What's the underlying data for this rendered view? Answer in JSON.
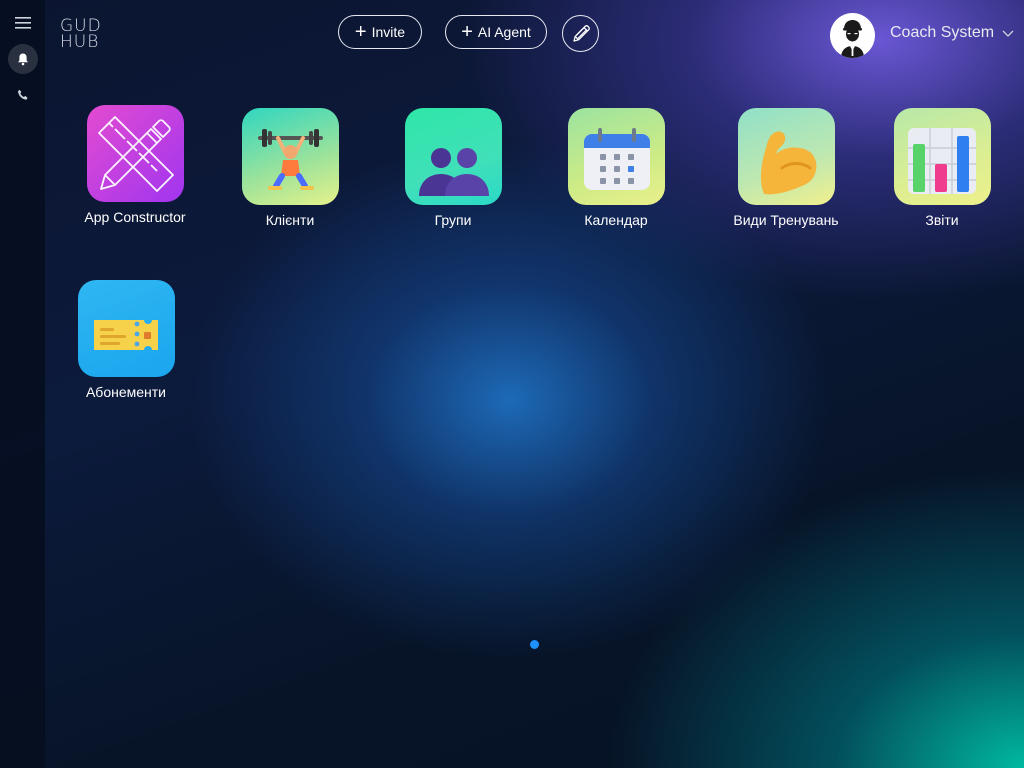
{
  "logo": {
    "line1": "GUD",
    "line2": "HUB"
  },
  "header": {
    "invite_label": "Invite",
    "ai_agent_label": "AI Agent",
    "user_name": "Coach System"
  },
  "sidebar": {
    "items": [
      {
        "icon": "menu-icon"
      },
      {
        "icon": "bell-icon"
      },
      {
        "icon": "phone-icon"
      }
    ]
  },
  "apps": [
    {
      "label": "App Constructor",
      "icon": "pencil-ruler-icon"
    },
    {
      "label": "Клієнти",
      "icon": "weightlifter-icon"
    },
    {
      "label": "Групи",
      "icon": "group-users-icon"
    },
    {
      "label": "Календар",
      "icon": "calendar-icon"
    },
    {
      "label": "Види Тренувань",
      "icon": "biceps-icon"
    },
    {
      "label": "Звіти",
      "icon": "bar-chart-icon"
    },
    {
      "label": "Абонементи",
      "icon": "ticket-icon"
    }
  ],
  "pagination": {
    "pages": 1,
    "current": 1
  },
  "colors": {
    "accent": "#1e90ff",
    "text": "#ffffff"
  }
}
